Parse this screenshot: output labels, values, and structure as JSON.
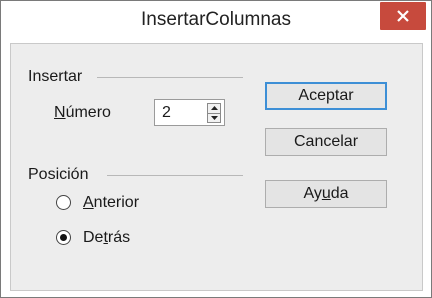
{
  "window": {
    "title": "InsertarColumnas"
  },
  "insert_group": {
    "label": "Insertar",
    "number_label_prefix": "N",
    "number_label_rest": "úmero",
    "number_value": "2"
  },
  "position_group": {
    "label": "Posición",
    "before_prefix": "A",
    "before_rest": "nterior",
    "after_a": "De",
    "after_u": "t",
    "after_b": "rás",
    "selected": "after"
  },
  "buttons": {
    "ok": "Aceptar",
    "cancel": "Cancelar",
    "help_a": "Ay",
    "help_u": "u",
    "help_b": "da"
  }
}
